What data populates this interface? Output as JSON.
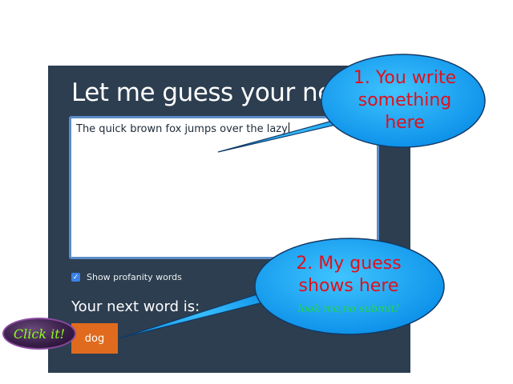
{
  "title": "Let me guess your next word",
  "input": {
    "value": "The quick brown fox jumps over the lazy"
  },
  "profanity": {
    "label": "Show profanity words",
    "checked": true
  },
  "result": {
    "label": "Your next word is:",
    "word": "dog"
  },
  "annotations": {
    "click_label": "Click it!",
    "bubble1": [
      "1. You write",
      "something",
      "here"
    ],
    "bubble2": [
      "2. My guess",
      "shows here"
    ],
    "bubble2_sub": "look ma,no submit!",
    "colors": {
      "bubble_fill": "#1aa3f5",
      "bubble_text": "#e0101a",
      "sub_text": "#22d64a",
      "click_text": "#8cff1a"
    }
  },
  "colors": {
    "panel": "#2c3e50",
    "button": "#e06b1e",
    "checkbox": "#3b82e8",
    "textarea_border": "#5b8cc9"
  }
}
